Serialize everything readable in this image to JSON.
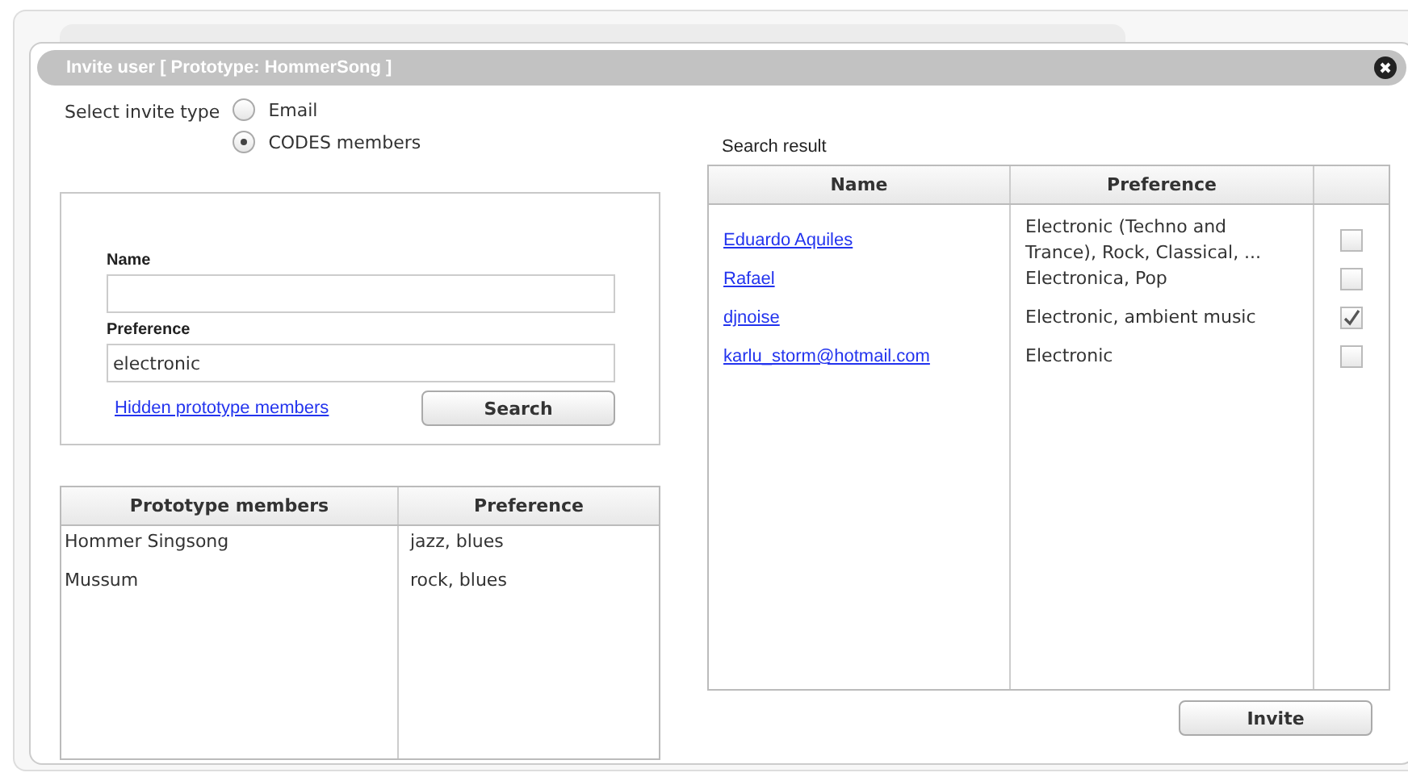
{
  "dialog": {
    "title": "Invite user [ Prototype: HommerSong ]"
  },
  "invite_type": {
    "label": "Select invite type",
    "options": [
      {
        "label": "Email",
        "selected": false
      },
      {
        "label": "CODES members",
        "selected": true
      }
    ]
  },
  "search_form": {
    "fields": [
      {
        "label": "Name"
      },
      {
        "label": "Preference",
        "value": "electronic"
      }
    ],
    "link": "Hidden prototype members",
    "button": "Search"
  },
  "members_table": {
    "columns": [
      "Prototype members",
      "Preference"
    ],
    "rows": [
      [
        "Hommer Singsong",
        "jazz, blues"
      ],
      [
        "Mussum",
        "rock, blues"
      ]
    ]
  },
  "search_result": {
    "title": "Search result",
    "columns": [
      "Name",
      "Preference"
    ],
    "rows": [
      {
        "name": "Eduardo Aquiles",
        "preference": "Electronic (Techno and Trance), Rock, Classical, ...",
        "checked": false
      },
      {
        "name": "Rafael",
        "preference": "Electronica, Pop",
        "checked": false
      },
      {
        "name": "djnoise",
        "preference": "Electronic, ambient music",
        "checked": true
      },
      {
        "name": "karlu_storm@hotmail.com",
        "preference": "Electronic",
        "checked": false
      }
    ]
  },
  "invite_button": "Invite"
}
